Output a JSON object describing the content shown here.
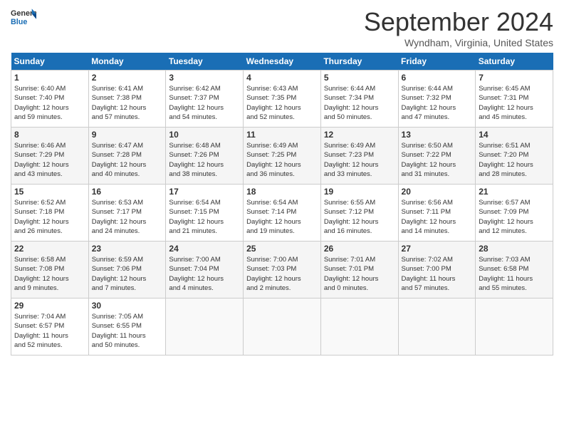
{
  "header": {
    "logo_line1": "General",
    "logo_line2": "Blue",
    "month_title": "September 2024",
    "location": "Wyndham, Virginia, United States"
  },
  "days_of_week": [
    "Sunday",
    "Monday",
    "Tuesday",
    "Wednesday",
    "Thursday",
    "Friday",
    "Saturday"
  ],
  "weeks": [
    [
      {
        "day": "1",
        "detail": "Sunrise: 6:40 AM\nSunset: 7:40 PM\nDaylight: 12 hours\nand 59 minutes."
      },
      {
        "day": "2",
        "detail": "Sunrise: 6:41 AM\nSunset: 7:38 PM\nDaylight: 12 hours\nand 57 minutes."
      },
      {
        "day": "3",
        "detail": "Sunrise: 6:42 AM\nSunset: 7:37 PM\nDaylight: 12 hours\nand 54 minutes."
      },
      {
        "day": "4",
        "detail": "Sunrise: 6:43 AM\nSunset: 7:35 PM\nDaylight: 12 hours\nand 52 minutes."
      },
      {
        "day": "5",
        "detail": "Sunrise: 6:44 AM\nSunset: 7:34 PM\nDaylight: 12 hours\nand 50 minutes."
      },
      {
        "day": "6",
        "detail": "Sunrise: 6:44 AM\nSunset: 7:32 PM\nDaylight: 12 hours\nand 47 minutes."
      },
      {
        "day": "7",
        "detail": "Sunrise: 6:45 AM\nSunset: 7:31 PM\nDaylight: 12 hours\nand 45 minutes."
      }
    ],
    [
      {
        "day": "8",
        "detail": "Sunrise: 6:46 AM\nSunset: 7:29 PM\nDaylight: 12 hours\nand 43 minutes."
      },
      {
        "day": "9",
        "detail": "Sunrise: 6:47 AM\nSunset: 7:28 PM\nDaylight: 12 hours\nand 40 minutes."
      },
      {
        "day": "10",
        "detail": "Sunrise: 6:48 AM\nSunset: 7:26 PM\nDaylight: 12 hours\nand 38 minutes."
      },
      {
        "day": "11",
        "detail": "Sunrise: 6:49 AM\nSunset: 7:25 PM\nDaylight: 12 hours\nand 36 minutes."
      },
      {
        "day": "12",
        "detail": "Sunrise: 6:49 AM\nSunset: 7:23 PM\nDaylight: 12 hours\nand 33 minutes."
      },
      {
        "day": "13",
        "detail": "Sunrise: 6:50 AM\nSunset: 7:22 PM\nDaylight: 12 hours\nand 31 minutes."
      },
      {
        "day": "14",
        "detail": "Sunrise: 6:51 AM\nSunset: 7:20 PM\nDaylight: 12 hours\nand 28 minutes."
      }
    ],
    [
      {
        "day": "15",
        "detail": "Sunrise: 6:52 AM\nSunset: 7:18 PM\nDaylight: 12 hours\nand 26 minutes."
      },
      {
        "day": "16",
        "detail": "Sunrise: 6:53 AM\nSunset: 7:17 PM\nDaylight: 12 hours\nand 24 minutes."
      },
      {
        "day": "17",
        "detail": "Sunrise: 6:54 AM\nSunset: 7:15 PM\nDaylight: 12 hours\nand 21 minutes."
      },
      {
        "day": "18",
        "detail": "Sunrise: 6:54 AM\nSunset: 7:14 PM\nDaylight: 12 hours\nand 19 minutes."
      },
      {
        "day": "19",
        "detail": "Sunrise: 6:55 AM\nSunset: 7:12 PM\nDaylight: 12 hours\nand 16 minutes."
      },
      {
        "day": "20",
        "detail": "Sunrise: 6:56 AM\nSunset: 7:11 PM\nDaylight: 12 hours\nand 14 minutes."
      },
      {
        "day": "21",
        "detail": "Sunrise: 6:57 AM\nSunset: 7:09 PM\nDaylight: 12 hours\nand 12 minutes."
      }
    ],
    [
      {
        "day": "22",
        "detail": "Sunrise: 6:58 AM\nSunset: 7:08 PM\nDaylight: 12 hours\nand 9 minutes."
      },
      {
        "day": "23",
        "detail": "Sunrise: 6:59 AM\nSunset: 7:06 PM\nDaylight: 12 hours\nand 7 minutes."
      },
      {
        "day": "24",
        "detail": "Sunrise: 7:00 AM\nSunset: 7:04 PM\nDaylight: 12 hours\nand 4 minutes."
      },
      {
        "day": "25",
        "detail": "Sunrise: 7:00 AM\nSunset: 7:03 PM\nDaylight: 12 hours\nand 2 minutes."
      },
      {
        "day": "26",
        "detail": "Sunrise: 7:01 AM\nSunset: 7:01 PM\nDaylight: 12 hours\nand 0 minutes."
      },
      {
        "day": "27",
        "detail": "Sunrise: 7:02 AM\nSunset: 7:00 PM\nDaylight: 11 hours\nand 57 minutes."
      },
      {
        "day": "28",
        "detail": "Sunrise: 7:03 AM\nSunset: 6:58 PM\nDaylight: 11 hours\nand 55 minutes."
      }
    ],
    [
      {
        "day": "29",
        "detail": "Sunrise: 7:04 AM\nSunset: 6:57 PM\nDaylight: 11 hours\nand 52 minutes."
      },
      {
        "day": "30",
        "detail": "Sunrise: 7:05 AM\nSunset: 6:55 PM\nDaylight: 11 hours\nand 50 minutes."
      },
      {
        "day": "",
        "detail": ""
      },
      {
        "day": "",
        "detail": ""
      },
      {
        "day": "",
        "detail": ""
      },
      {
        "day": "",
        "detail": ""
      },
      {
        "day": "",
        "detail": ""
      }
    ]
  ]
}
